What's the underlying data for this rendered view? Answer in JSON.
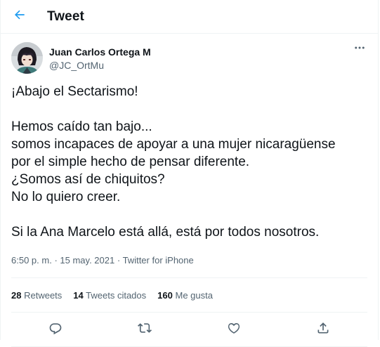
{
  "header": {
    "title": "Tweet",
    "back_icon": "arrow-left-icon",
    "accent": "#1d9bf0"
  },
  "author": {
    "display_name": "Juan Carlos Ortega M",
    "handle": "@JC_OrtMu",
    "more_icon": "more-horizontal-icon"
  },
  "tweet": {
    "lines": [
      "¡Abajo el Sectarismo!",
      "",
      "Hemos caído tan bajo...",
      "somos incapaces de apoyar a una mujer nicaragüense",
      "por el simple hecho de pensar diferente.",
      "¿Somos así de chiquitos?",
      "No lo quiero creer.",
      "",
      "Si la Ana Marcelo está allá, está por todos nosotros."
    ]
  },
  "meta": {
    "time": "6:50 p. m.",
    "separator": "·",
    "date": "15 may. 2021",
    "source": "Twitter for iPhone"
  },
  "stats": {
    "retweets_count": "28",
    "retweets_label": "Retweets",
    "quotes_count": "14",
    "quotes_label": "Tweets citados",
    "likes_count": "160",
    "likes_label": "Me gusta"
  },
  "actions": {
    "reply_icon": "reply-icon",
    "retweet_icon": "retweet-icon",
    "like_icon": "heart-icon",
    "share_icon": "share-icon"
  },
  "colors": {
    "text": "#0f1419",
    "secondary": "#536471",
    "border": "#eff3f4",
    "back_arrow": "#1d9bf0"
  }
}
